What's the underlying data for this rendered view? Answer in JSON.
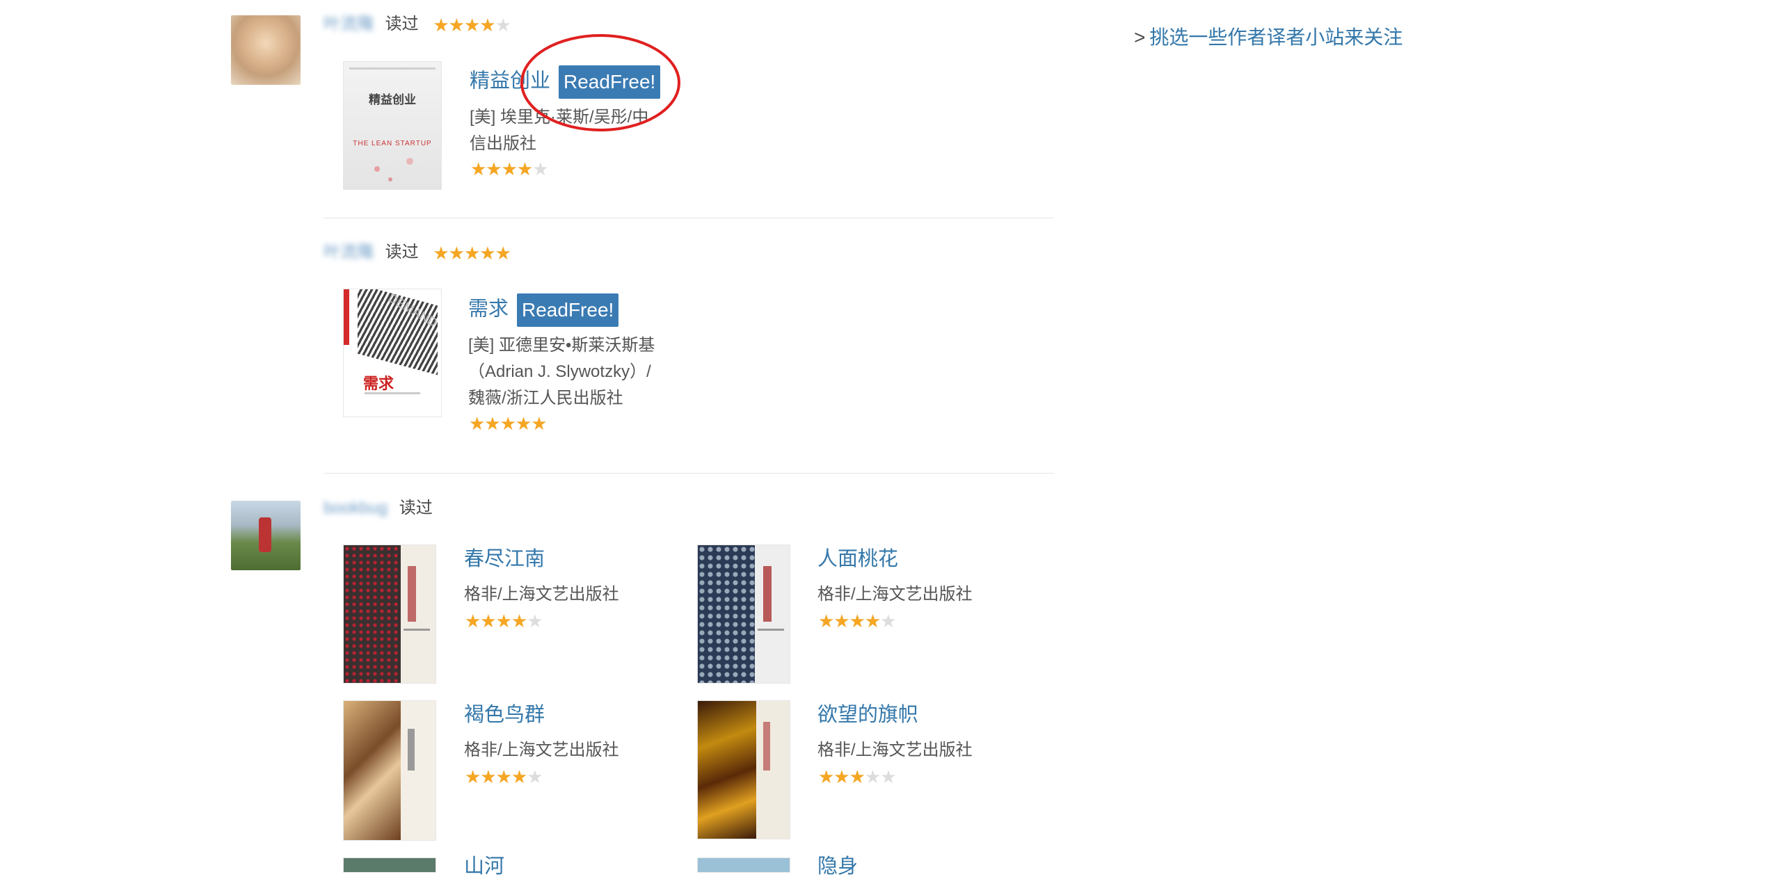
{
  "sidebar": {
    "follow_prompt": "挑选一些作者译者小站来关注",
    "prefix": ">"
  },
  "entries": [
    {
      "user": "叶流殤",
      "verb": "读过",
      "user_rating": 4,
      "book": {
        "title": "精益创业",
        "readfree": "ReadFree!",
        "meta_lines": [
          "[美] 埃里克·莱斯/吴彤/中",
          "信出版社"
        ],
        "rating": 4,
        "cover": {
          "title": "精益创业",
          "subtitle": "THE LEAN STARTUP"
        }
      }
    },
    {
      "user": "叶流殤",
      "verb": "读过",
      "user_rating": 5,
      "book": {
        "title": "需求",
        "readfree": "ReadFree!",
        "meta_lines": [
          "[美] 亚德里安•斯莱沃斯基",
          "（Adrian J. Slywotzky）/",
          "魏薇/浙江人民出版社"
        ],
        "rating": 5,
        "cover": {
          "title": "需求",
          "subtitle": "DEMAND"
        }
      }
    },
    {
      "user": "bookbug",
      "verb": "读过",
      "books": [
        {
          "title": "春尽江南",
          "meta": "格非/上海文艺出版社",
          "rating": 4
        },
        {
          "title": "人面桃花",
          "meta": "格非/上海文艺出版社",
          "rating": 4
        },
        {
          "title": "褐色鸟群",
          "meta": "格非/上海文艺出版社",
          "rating": 4
        },
        {
          "title": "欲望的旗帜",
          "meta": "格非/上海文艺出版社",
          "rating": 3
        },
        {
          "title": "山河",
          "meta": "",
          "rating": 0
        },
        {
          "title": "隐身",
          "meta": "",
          "rating": 0
        }
      ]
    }
  ],
  "colors": {
    "link": "#3377aa",
    "star": "#f6a623",
    "readfree_bg": "#3b7bb3",
    "annotation": "#e02020"
  },
  "icons": {
    "star": "star-icon"
  }
}
